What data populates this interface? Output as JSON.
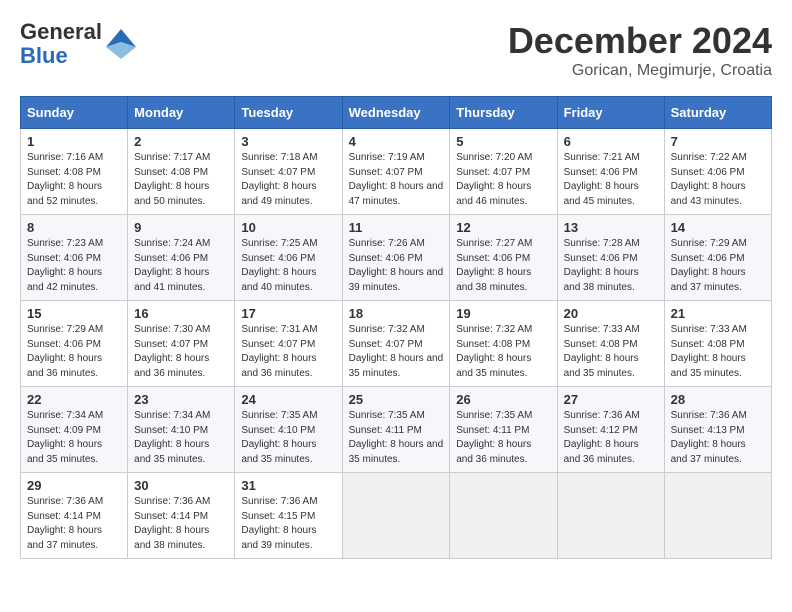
{
  "header": {
    "logo": {
      "line1": "General",
      "line2": "Blue"
    },
    "title": "December 2024",
    "subtitle": "Gorican, Megimurje, Croatia"
  },
  "calendar": {
    "days_of_week": [
      "Sunday",
      "Monday",
      "Tuesday",
      "Wednesday",
      "Thursday",
      "Friday",
      "Saturday"
    ],
    "weeks": [
      [
        {
          "day": "1",
          "sunrise": "7:16 AM",
          "sunset": "4:08 PM",
          "daylight": "8 hours and 52 minutes."
        },
        {
          "day": "2",
          "sunrise": "7:17 AM",
          "sunset": "4:08 PM",
          "daylight": "8 hours and 50 minutes."
        },
        {
          "day": "3",
          "sunrise": "7:18 AM",
          "sunset": "4:07 PM",
          "daylight": "8 hours and 49 minutes."
        },
        {
          "day": "4",
          "sunrise": "7:19 AM",
          "sunset": "4:07 PM",
          "daylight": "8 hours and 47 minutes."
        },
        {
          "day": "5",
          "sunrise": "7:20 AM",
          "sunset": "4:07 PM",
          "daylight": "8 hours and 46 minutes."
        },
        {
          "day": "6",
          "sunrise": "7:21 AM",
          "sunset": "4:06 PM",
          "daylight": "8 hours and 45 minutes."
        },
        {
          "day": "7",
          "sunrise": "7:22 AM",
          "sunset": "4:06 PM",
          "daylight": "8 hours and 43 minutes."
        }
      ],
      [
        {
          "day": "8",
          "sunrise": "7:23 AM",
          "sunset": "4:06 PM",
          "daylight": "8 hours and 42 minutes."
        },
        {
          "day": "9",
          "sunrise": "7:24 AM",
          "sunset": "4:06 PM",
          "daylight": "8 hours and 41 minutes."
        },
        {
          "day": "10",
          "sunrise": "7:25 AM",
          "sunset": "4:06 PM",
          "daylight": "8 hours and 40 minutes."
        },
        {
          "day": "11",
          "sunrise": "7:26 AM",
          "sunset": "4:06 PM",
          "daylight": "8 hours and 39 minutes."
        },
        {
          "day": "12",
          "sunrise": "7:27 AM",
          "sunset": "4:06 PM",
          "daylight": "8 hours and 38 minutes."
        },
        {
          "day": "13",
          "sunrise": "7:28 AM",
          "sunset": "4:06 PM",
          "daylight": "8 hours and 38 minutes."
        },
        {
          "day": "14",
          "sunrise": "7:29 AM",
          "sunset": "4:06 PM",
          "daylight": "8 hours and 37 minutes."
        }
      ],
      [
        {
          "day": "15",
          "sunrise": "7:29 AM",
          "sunset": "4:06 PM",
          "daylight": "8 hours and 36 minutes."
        },
        {
          "day": "16",
          "sunrise": "7:30 AM",
          "sunset": "4:07 PM",
          "daylight": "8 hours and 36 minutes."
        },
        {
          "day": "17",
          "sunrise": "7:31 AM",
          "sunset": "4:07 PM",
          "daylight": "8 hours and 36 minutes."
        },
        {
          "day": "18",
          "sunrise": "7:32 AM",
          "sunset": "4:07 PM",
          "daylight": "8 hours and 35 minutes."
        },
        {
          "day": "19",
          "sunrise": "7:32 AM",
          "sunset": "4:08 PM",
          "daylight": "8 hours and 35 minutes."
        },
        {
          "day": "20",
          "sunrise": "7:33 AM",
          "sunset": "4:08 PM",
          "daylight": "8 hours and 35 minutes."
        },
        {
          "day": "21",
          "sunrise": "7:33 AM",
          "sunset": "4:08 PM",
          "daylight": "8 hours and 35 minutes."
        }
      ],
      [
        {
          "day": "22",
          "sunrise": "7:34 AM",
          "sunset": "4:09 PM",
          "daylight": "8 hours and 35 minutes."
        },
        {
          "day": "23",
          "sunrise": "7:34 AM",
          "sunset": "4:10 PM",
          "daylight": "8 hours and 35 minutes."
        },
        {
          "day": "24",
          "sunrise": "7:35 AM",
          "sunset": "4:10 PM",
          "daylight": "8 hours and 35 minutes."
        },
        {
          "day": "25",
          "sunrise": "7:35 AM",
          "sunset": "4:11 PM",
          "daylight": "8 hours and 35 minutes."
        },
        {
          "day": "26",
          "sunrise": "7:35 AM",
          "sunset": "4:11 PM",
          "daylight": "8 hours and 36 minutes."
        },
        {
          "day": "27",
          "sunrise": "7:36 AM",
          "sunset": "4:12 PM",
          "daylight": "8 hours and 36 minutes."
        },
        {
          "day": "28",
          "sunrise": "7:36 AM",
          "sunset": "4:13 PM",
          "daylight": "8 hours and 37 minutes."
        }
      ],
      [
        {
          "day": "29",
          "sunrise": "7:36 AM",
          "sunset": "4:14 PM",
          "daylight": "8 hours and 37 minutes."
        },
        {
          "day": "30",
          "sunrise": "7:36 AM",
          "sunset": "4:14 PM",
          "daylight": "8 hours and 38 minutes."
        },
        {
          "day": "31",
          "sunrise": "7:36 AM",
          "sunset": "4:15 PM",
          "daylight": "8 hours and 39 minutes."
        },
        null,
        null,
        null,
        null
      ]
    ]
  }
}
